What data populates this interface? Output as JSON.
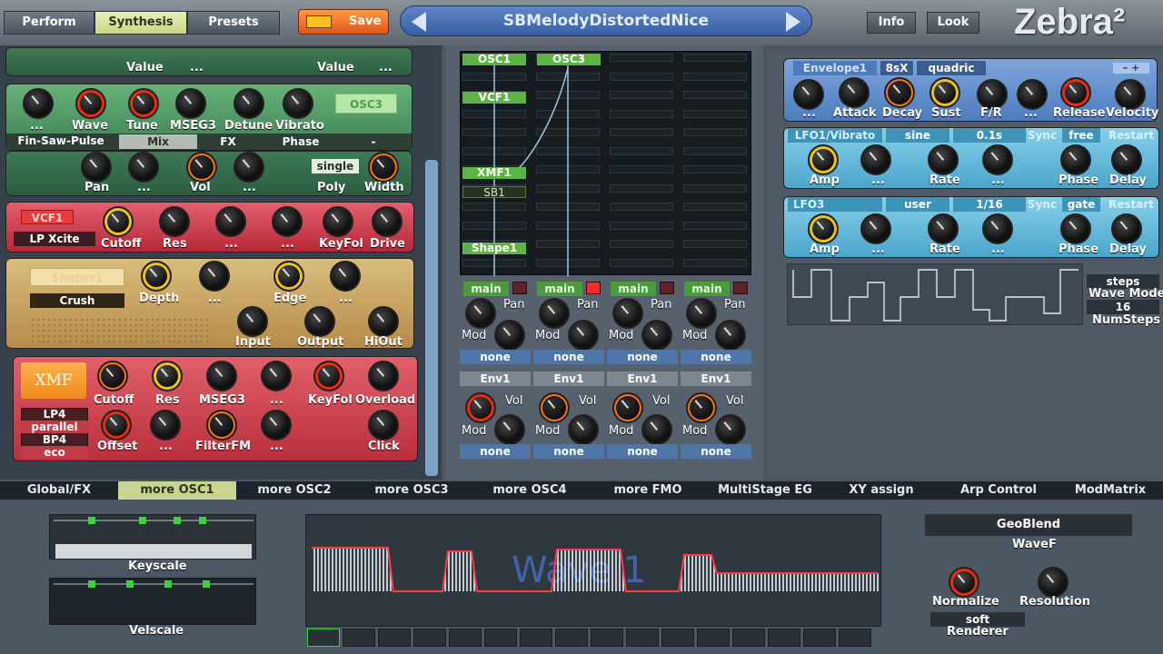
{
  "header": {
    "tabs": [
      {
        "label": "Perform"
      },
      {
        "label": "Synthesis"
      },
      {
        "label": "Presets"
      }
    ],
    "save_label": "Save",
    "preset_name": "SBMelodyDistortedNice",
    "info_label": "Info",
    "look_label": "Look",
    "logo": "Zebra²"
  },
  "osc": {
    "top_labels": [
      "Value",
      "...",
      "Value",
      "..."
    ],
    "knob_labels": [
      "...",
      "Wave",
      "Tune",
      "MSEG3",
      "Detune",
      "Vibrato"
    ],
    "badge": "OSC3",
    "wave_name": "Fin-Saw-Pulse",
    "subtabs": [
      "Mix",
      "FX",
      "Phase",
      "-"
    ],
    "row2_labels": [
      "Pan",
      "...",
      "Vol",
      "...",
      "Poly",
      "Width"
    ],
    "poly_value": "single"
  },
  "vcf": {
    "name": "VCF1",
    "type": "LP Xcite",
    "labels": [
      "Cutoff",
      "Res",
      "...",
      "...",
      "KeyFol",
      "Drive"
    ]
  },
  "shaper": {
    "name": "Shaper1",
    "type": "Crush",
    "labels": [
      "Depth",
      "...",
      "Edge",
      "...",
      "Input",
      "Output",
      "HiOut"
    ]
  },
  "xmf": {
    "name": "XMF",
    "modes": [
      "LP4",
      "parallel",
      "BP4",
      "eco"
    ],
    "row1": [
      "Cutoff",
      "Res",
      "MSEG3",
      "...",
      "KeyFol",
      "Overload"
    ],
    "row2": [
      "Offset",
      "...",
      "FilterFM",
      "...",
      "Click"
    ]
  },
  "matrix": {
    "columns": [
      "OSC1",
      "OSC3"
    ],
    "slots": [
      "VCF1",
      "XMF1",
      "SB1",
      "Shape1"
    ],
    "outputs": [
      {
        "bus": "main",
        "pan": "Pan",
        "mod": "Mod",
        "mod_src": "none",
        "env": "Env1",
        "vol": "Vol",
        "env_mod": "Mod",
        "env_src": "none"
      },
      {
        "bus": "main",
        "pan": "Pan",
        "mod": "Mod",
        "mod_src": "none",
        "env": "Env1",
        "vol": "Vol",
        "env_mod": "Mod",
        "env_src": "none"
      },
      {
        "bus": "main",
        "pan": "Pan",
        "mod": "Mod",
        "mod_src": "none",
        "env": "Env1",
        "vol": "Vol",
        "env_mod": "Mod",
        "env_src": "none"
      },
      {
        "bus": "main",
        "pan": "Pan",
        "mod": "Mod",
        "mod_src": "none",
        "env": "Env1",
        "vol": "Vol",
        "env_mod": "Mod",
        "env_src": "none"
      }
    ]
  },
  "envelope": {
    "name": "Envelope1",
    "time": "8sX",
    "curve": "quadric",
    "labels": [
      "...",
      "Attack",
      "Decay",
      "Sust",
      "F/R",
      "...",
      "Release",
      "Velocity"
    ]
  },
  "lfo1": {
    "name": "LFO1/Vibrato",
    "wave": "sine",
    "rate": "0.1s",
    "sync": "Sync",
    "mode": "free",
    "restart": "Restart",
    "labels": [
      "Amp",
      "...",
      "Rate",
      "...",
      "Phase",
      "Delay"
    ]
  },
  "lfo3": {
    "name": "LFO3",
    "wave": "user",
    "rate": "1/16",
    "sync": "Sync",
    "mode": "gate",
    "restart": "Restart",
    "labels": [
      "Amp",
      "...",
      "Rate",
      "...",
      "Phase",
      "Delay"
    ]
  },
  "steps": {
    "mode_value": "steps",
    "mode_label": "Wave Mode",
    "num_value": "16",
    "num_label": "NumSteps"
  },
  "bottom_tabs": [
    "Global/FX",
    "more OSC1",
    "more OSC2",
    "more OSC3",
    "more OSC4",
    "more FMO",
    "MultiStage EG",
    "XY assign",
    "Arp Control",
    "ModMatrix"
  ],
  "wave_editor": {
    "keyscale": "Keyscale",
    "velscale": "Velscale",
    "wave_title": "Wave 1",
    "blend_mode": "GeoBlend",
    "blend_label": "WaveF",
    "normalize": "Normalize",
    "resolution": "Resolution",
    "renderer_value": "soft",
    "renderer_label": "Renderer"
  },
  "colors": {
    "synth_green": "#5fa06a",
    "vcf_red": "#d23c48",
    "shaper_tan": "#c9a562",
    "xmf_red": "#d03a47",
    "env_blue": "#5e8ac3",
    "lfo_cyan": "#5ab6d6",
    "matrix_green": "#5db444"
  }
}
